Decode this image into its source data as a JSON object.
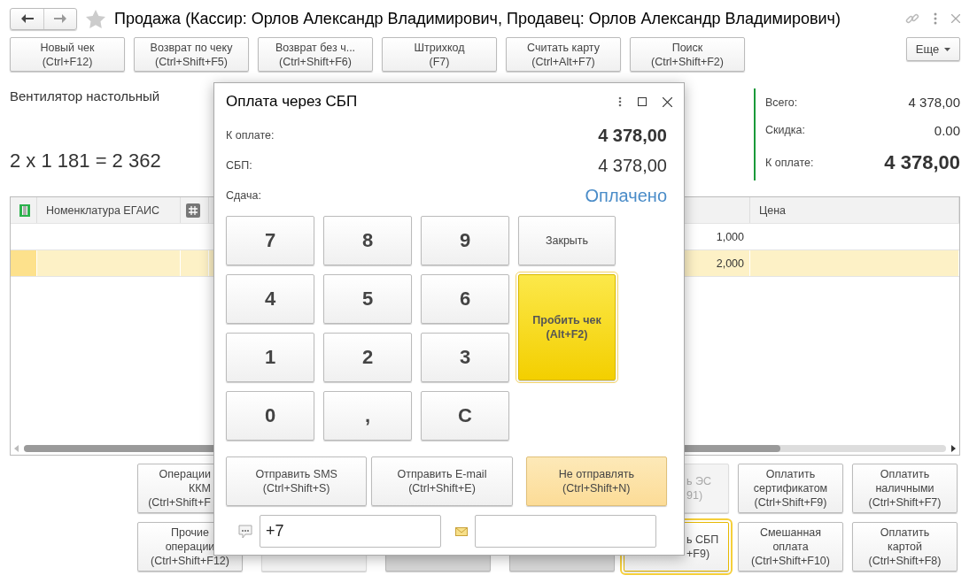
{
  "window": {
    "title": "Продажа (Кассир: Орлов Александр Владимирович, Продавец: Орлов Александр Владимирович)"
  },
  "toolbar": {
    "buttons": [
      {
        "label": "Новый чек",
        "shortcut": "(Ctrl+F12)"
      },
      {
        "label": "Возврат по чеку",
        "shortcut": "(Ctrl+Shift+F5)"
      },
      {
        "label": "Возврат без ч...",
        "shortcut": "(Ctrl+Shift+F6)"
      },
      {
        "label": "Штрихкод",
        "shortcut": "(F7)"
      },
      {
        "label": "Считать карту",
        "shortcut": "(Ctrl+Alt+F7)"
      },
      {
        "label": "Поиск",
        "shortcut": "(Ctrl+Shift+F2)"
      }
    ],
    "more": "Еще"
  },
  "product": {
    "name": "Вентилятор настольный",
    "calculation": "2 x 1 181 = 2 362"
  },
  "totals": [
    {
      "label": "Всего:",
      "value": "4 378,00",
      "kind": "plain"
    },
    {
      "label": "Скидка:",
      "value": "0.00",
      "kind": "plain"
    },
    {
      "label": "К оплате:",
      "value": "4 378,00",
      "kind": "total"
    }
  ],
  "table": {
    "columns": [
      {
        "kind": "egais-icon"
      },
      {
        "kind": "text",
        "label": "Номенклатура ЕГАИС"
      },
      {
        "kind": "hash-icon"
      },
      {
        "kind": "covered"
      },
      {
        "kind": "text",
        "label": "Цена"
      }
    ],
    "rows": [
      {
        "column_4": "1,000",
        "selected": false
      },
      {
        "column_4": "2,000",
        "selected": true
      }
    ]
  },
  "actions": [
    [
      {
        "kind": "cut-right",
        "lines": [
          "Операции",
          "ККМ",
          "(Ctrl+Shift+F"
        ]
      },
      {
        "kind": "hidden"
      },
      {
        "kind": "hidden"
      },
      {
        "kind": "hidden"
      },
      {
        "kind": "cut-left",
        "disabled": true,
        "focused": false,
        "lines": [
          "ь ЭС",
          "91)"
        ]
      },
      {
        "kind": "normal",
        "lines": [
          "Оплатить",
          "сертификатом",
          "(Ctrl+Shift+F9)"
        ]
      },
      {
        "kind": "normal",
        "lines": [
          "Оплатить",
          "наличными",
          "(Ctrl+Shift+F7)"
        ]
      }
    ],
    [
      {
        "kind": "normal",
        "lines": [
          "Прочие",
          "операции",
          "(Ctrl+Shift+F12)"
        ]
      },
      {
        "kind": "blank",
        "disabled": true
      },
      {
        "kind": "blank",
        "disabled": false
      },
      {
        "kind": "blank",
        "disabled": false
      },
      {
        "kind": "cut-left",
        "disabled": false,
        "focused": true,
        "lines": [
          "ь СБП",
          "+F9)"
        ]
      },
      {
        "kind": "normal",
        "lines": [
          "Смешанная",
          "оплата",
          "(Ctrl+Shift+F10)"
        ]
      },
      {
        "kind": "normal",
        "lines": [
          "Оплатить",
          "картой",
          "(Ctrl+Shift+F8)"
        ]
      }
    ]
  ],
  "dialog": {
    "title": "Оплата через СБП",
    "amounts": [
      {
        "label": "К оплате:",
        "value": "4 378,00",
        "kind": "bold"
      },
      {
        "label": "СБП:",
        "value": "4 378,00",
        "kind": "plain"
      },
      {
        "label": "Сдача:",
        "value": "Оплачено",
        "kind": "status"
      }
    ],
    "keys": [
      "7",
      "8",
      "9",
      "4",
      "5",
      "6",
      "1",
      "2",
      "3",
      "0",
      ",",
      "C"
    ],
    "close_button": "Закрыть",
    "print_button": {
      "label": "Пробить чек",
      "shortcut": "(Alt+F2)"
    },
    "send_buttons": [
      {
        "label": "Отправить SMS",
        "shortcut": "(Ctrl+Shift+S)",
        "selected": false
      },
      {
        "label": "Отправить E-mail",
        "shortcut": "(Ctrl+Shift+E)",
        "selected": false
      },
      {
        "label": "Не отправлять",
        "shortcut": "(Ctrl+Shift+N)",
        "selected": true
      }
    ],
    "phone": {
      "value": "+7"
    }
  }
}
